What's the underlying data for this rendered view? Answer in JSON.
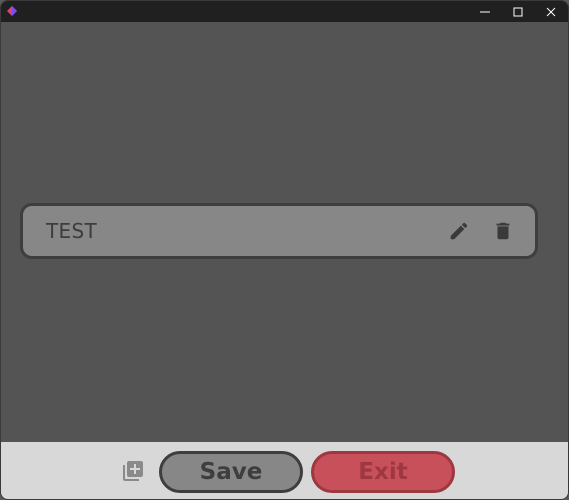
{
  "window": {
    "controls": {
      "minimize_icon": "minimize-icon",
      "maximize_icon": "maximize-icon",
      "close_icon": "close-icon"
    }
  },
  "list": {
    "items": [
      {
        "label": "TEST",
        "edit_icon": "pencil-icon",
        "delete_icon": "trash-icon"
      }
    ]
  },
  "footer": {
    "add_icon": "add-to-library-icon",
    "save_label": "Save",
    "exit_label": "Exit"
  },
  "colors": {
    "background": "#545454",
    "item_fill": "#878787",
    "item_border": "#3e3e3e",
    "footer": "#d8d8d8",
    "exit_fill": "#c8505a",
    "exit_text": "#9e3840"
  }
}
